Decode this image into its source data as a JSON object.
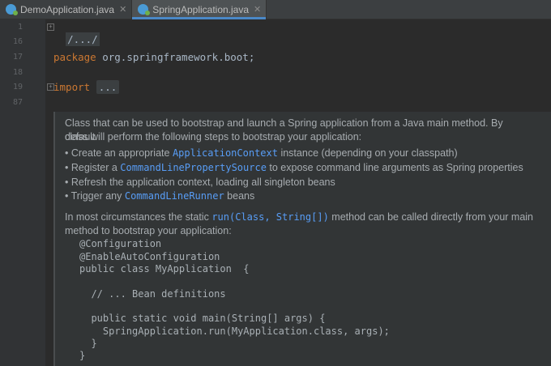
{
  "tabs": [
    {
      "label": "DemoApplication.java",
      "active": false
    },
    {
      "label": "SpringApplication.java",
      "active": true
    }
  ],
  "close_glyph": "✕",
  "gutter": {
    "lines": [
      "1",
      "16",
      "17",
      "18",
      "19",
      "87"
    ]
  },
  "code": {
    "folded_header": "/.../",
    "package_kw": "package",
    "package_name": " org.springframework.boot;",
    "import_kw": "import",
    "import_folded": "..."
  },
  "doc": {
    "intro_line1": "Class that can be used to bootstrap and launch a Spring application from a Java main method. By default",
    "intro_line2": "class will perform the following steps to bootstrap your application:",
    "bullets": [
      {
        "pre": "• Create an appropriate ",
        "link": "ApplicationContext",
        "post": " instance (depending on your classpath)"
      },
      {
        "pre": "• Register a ",
        "link": "CommandLinePropertySource",
        "post": " to expose command line arguments as Spring properties"
      },
      {
        "pre": "• Refresh the application context, loading all singleton beans",
        "link": "",
        "post": ""
      },
      {
        "pre": "• Trigger any ",
        "link": "CommandLineRunner",
        "post": " beans"
      }
    ],
    "para2_pre": "In most circumstances the static ",
    "para2_link": "run(Class, String[])",
    "para2_post": " method can be called directly from your main",
    "para2_line2": "method to bootstrap your application:",
    "example": [
      "@Configuration",
      "@EnableAutoConfiguration",
      "public class MyApplication  {",
      "",
      "  // ... Bean definitions",
      "",
      "  public static void main(String[] args) {",
      "    SpringApplication.run(MyApplication.class, args);",
      "  }",
      "}"
    ]
  },
  "colors": {
    "background": "#2b2b2b",
    "keyword": "#cc7832",
    "link": "#589df6",
    "active_tab_underline": "#4a88c7"
  }
}
